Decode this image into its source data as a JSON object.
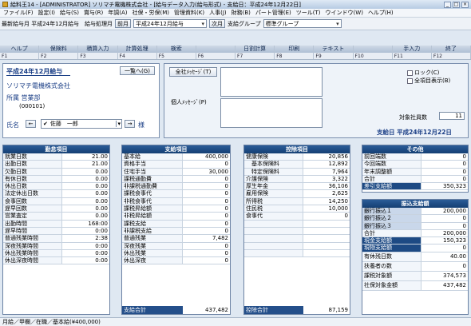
{
  "window": {
    "title": "給料王14 - [ADMINISTRATOR] ソリマチ電機株式会社 - [給与データ入力(給与形式) - 支給日：平成24年12月22日]"
  },
  "menu": [
    "ファイル(F)",
    "設定(I)",
    "給与(S)",
    "賞与(R)",
    "年調(A)",
    "社保・労保(M)",
    "管理資料(K)",
    "人事(J)",
    "財務(B)",
    "パート管理(E)",
    "ツール(T)",
    "ウインドウ(W)",
    "ヘルプ(H)"
  ],
  "toolbar": {
    "latest": "最新給与月 平成24年12月給与",
    "target_label": "給与処理月",
    "prev": "前月",
    "month": "平成24年12月給与",
    "next": "次月",
    "group_label": "支給グループ",
    "group": "標準グループ"
  },
  "fkeys": [
    {
      "label": "ヘルプ",
      "key": "F1"
    },
    {
      "label": "保険料",
      "key": "F2"
    },
    {
      "label": "積算入力",
      "key": "F3"
    },
    {
      "label": "計算処理",
      "key": "F4"
    },
    {
      "label": "検索",
      "key": "F5"
    },
    {
      "label": "",
      "key": "F6"
    },
    {
      "label": "日割計算",
      "key": "F7"
    },
    {
      "label": "印刷",
      "key": "F8"
    },
    {
      "label": "テキスト",
      "key": "F9"
    },
    {
      "label": "",
      "key": "F10"
    },
    {
      "label": "手入力",
      "key": "F11"
    },
    {
      "label": "終了",
      "key": "F12"
    }
  ],
  "header": {
    "payroll_title": "平成24年12月給与",
    "list_button": "一覧へ(G)",
    "company": "ソリマチ電機株式会社",
    "dept": "所属 営業部",
    "dept_code": "(000101)",
    "name_label": "氏名",
    "emp_name": "佐藤　一郎",
    "sama": "様",
    "msg_all": "全社ﾒｯｾｰｼﾞ(T)",
    "msg_personal": "個人ﾒｯｾｰｼﾞ(P)",
    "lock": "ロック(C)",
    "show_all": "全項目表示(B)",
    "target_count_label": "対象社員数",
    "target_count": "11",
    "payday": "支給日 平成24年12月22日"
  },
  "attendance": {
    "title": "勤怠項目",
    "rows": [
      [
        "就業日数",
        "21.00"
      ],
      [
        "出勤日数",
        "21.00"
      ],
      [
        "欠勤日数",
        "0.00"
      ],
      [
        "有休日数",
        "0.00"
      ],
      [
        "休出日数",
        "0.00"
      ],
      [
        "法定休出日数",
        "0.00"
      ],
      [
        "食事回数",
        "0.00"
      ],
      [
        "遅早回数",
        "0.00"
      ],
      [
        "営業査定",
        "0.00"
      ],
      [
        "出勤時間",
        "168:00"
      ],
      [
        "遅早時間",
        "0:00"
      ],
      [
        "普通残業時間",
        "2:38"
      ],
      [
        "深夜残業時間",
        "0:00"
      ],
      [
        "休出残業時間",
        "0:00"
      ],
      [
        "休出深夜時間",
        "0:00"
      ]
    ]
  },
  "payment": {
    "title": "支給項目",
    "rows": [
      [
        "基本給",
        "400,000"
      ],
      [
        "資格手当",
        "0"
      ],
      [
        "住宅手当",
        "30,000"
      ],
      [
        "課税通勤費",
        "0"
      ],
      [
        "非課税通勤費",
        "0"
      ],
      [
        "課税食事代",
        "0"
      ],
      [
        "非税食事代",
        "0"
      ],
      [
        "課税昇給額",
        "0"
      ],
      [
        "非税昇給額",
        "0"
      ],
      [
        "課税支給",
        "0"
      ],
      [
        "非課税支給",
        "0"
      ],
      [
        "普通残業",
        "7,482"
      ],
      [
        "深夜残業",
        "0"
      ],
      [
        "休出残業",
        "0"
      ],
      [
        "休出深夜",
        "0"
      ]
    ],
    "total_label": "支給合計",
    "total": "437,482"
  },
  "deduction": {
    "title": "控除項目",
    "rows": [
      [
        "健康保険",
        "20,856"
      ],
      [
        "　基本保険料",
        "12,892"
      ],
      [
        "　特定保険料",
        "7,964"
      ],
      [
        "介護保険",
        "3,322"
      ],
      [
        "厚生年金",
        "36,106"
      ],
      [
        "雇用保険",
        "2,625"
      ],
      [
        "所得税",
        "14,250"
      ],
      [
        "住民税",
        "10,000"
      ],
      [
        "食事代",
        "0"
      ],
      [
        "",
        ""
      ],
      [
        "",
        ""
      ],
      [
        "",
        ""
      ],
      [
        "",
        ""
      ],
      [
        "",
        ""
      ]
    ],
    "total_label": "控除合計",
    "total": "87,159"
  },
  "other": {
    "title": "その他",
    "rows": [
      [
        "前回端数",
        "0"
      ],
      [
        "今回端数",
        "0"
      ],
      [
        "年末調整額",
        "0"
      ],
      [
        "合計",
        "0"
      ],
      [
        "差引支給額",
        "350,323"
      ]
    ]
  },
  "transfer": {
    "title": "振込支給額",
    "rows": [
      [
        "銀行振込１",
        "200,000"
      ],
      [
        "銀行振込２",
        "0"
      ],
      [
        "銀行振込３",
        "0"
      ],
      [
        "合計",
        "200,000"
      ],
      [
        "現金支給額",
        "150,323"
      ],
      [
        "現物支給額",
        "0"
      ],
      [
        "有休残日数",
        "40.00"
      ],
      [
        "扶養者の数",
        "0"
      ],
      [
        "課税対象額",
        "374,573"
      ],
      [
        "社保対象金額",
        "437,482"
      ]
    ]
  },
  "status": "月給／甲欄／在職／基本給(¥400,000)"
}
